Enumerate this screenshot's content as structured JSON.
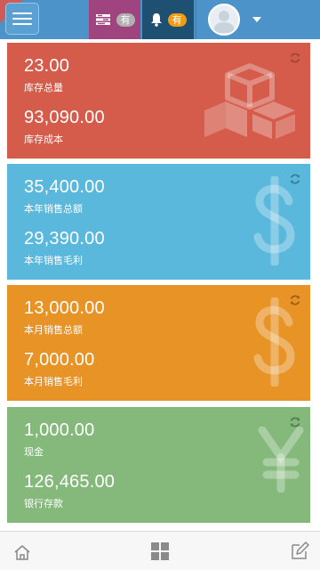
{
  "topbar": {
    "tasks_badge": "有",
    "notifications_badge": "有"
  },
  "cards": [
    {
      "value1": "23.00",
      "label1": "库存总量",
      "value2": "93,090.00",
      "label2": "库存成本",
      "icon": "cubes-icon"
    },
    {
      "value1": "35,400.00",
      "label1": "本年销售总额",
      "value2": "29,390.00",
      "label2": "本年销售毛利",
      "icon": "dollar-icon"
    },
    {
      "value1": "13,000.00",
      "label1": "本月销售总额",
      "value2": "7,000.00",
      "label2": "本月销售毛利",
      "icon": "dollar-icon"
    },
    {
      "value1": "1,000.00",
      "label1": "现金",
      "value2": "126,465.00",
      "label2": "银行存款",
      "icon": "yen-icon"
    }
  ],
  "colors": {
    "topbar": "#4c93c9",
    "red": "#d55b4a",
    "blue": "#5ab8dc",
    "orange": "#e79325",
    "green": "#85b97c"
  },
  "bottombar": {
    "icons": [
      "home-icon",
      "grid-icon",
      "edit-icon"
    ]
  }
}
